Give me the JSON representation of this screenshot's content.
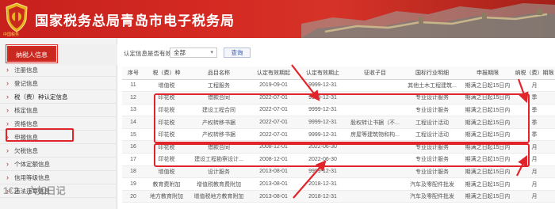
{
  "header": {
    "title": "国家税务总局青岛市电子税务局",
    "emblem_label": "中国税务"
  },
  "sidebar": {
    "head_label": "纳税人信息",
    "items": [
      {
        "label": "注册信息"
      },
      {
        "label": "登记信息"
      },
      {
        "label": "税（费）种认定信息"
      },
      {
        "label": "核定信息"
      },
      {
        "label": "资格信息"
      },
      {
        "label": "申报信息"
      },
      {
        "label": "欠税信息"
      },
      {
        "label": "个体定额信息"
      },
      {
        "label": "信用等级信息"
      },
      {
        "label": "违法违章信息"
      }
    ]
  },
  "filter": {
    "label": "认定信息是否有效:",
    "selected": "全部",
    "query_label": "查询"
  },
  "table": {
    "columns": [
      "序号",
      "税（费）种",
      "品目名称",
      "认定有效期起",
      "认定有效期止",
      "征收子目",
      "国标行业明细",
      "申报期限",
      "纳税（费）期限"
    ],
    "rows": [
      [
        "11",
        "增值税",
        "工程服务",
        "2019-09-01",
        "9999-12-31",
        "",
        "其他土木工程建筑...",
        "期满之日起15日内",
        "月"
      ],
      [
        "12",
        "印花税",
        "借款合同",
        "2022-07-01",
        "9999-12-31",
        "",
        "专业设计服务",
        "期满之日起15日内",
        "季"
      ],
      [
        "13",
        "印花税",
        "建设工程合同",
        "2022-07-01",
        "9999-12-31",
        "",
        "专业设计服务",
        "期满之日起15日内",
        "季"
      ],
      [
        "14",
        "印花税",
        "产权转移书据",
        "2022-07-01",
        "9999-12-31",
        "股权转让书据（不...",
        "工程设计活动",
        "期满之日起15日内",
        "季"
      ],
      [
        "15",
        "印花税",
        "产权转移书据",
        "2022-07-01",
        "9999-12-31",
        "房屋等建筑物和构...",
        "工程设计活动",
        "期满之日起15日内",
        "季"
      ],
      [
        "16",
        "印花税",
        "借款合同",
        "2008-12-01",
        "2022-06-30",
        "",
        "专业设计服务",
        "期满之日起15日内",
        "月"
      ],
      [
        "17",
        "印花税",
        "建设工程勘察设计...",
        "2008-12-01",
        "2022-06-30",
        "",
        "专业设计服务",
        "期满之日起15日内",
        "月"
      ],
      [
        "18",
        "增值税",
        "设计服务",
        "2013-08-01",
        "9999-12-31",
        "",
        "专业设计服务",
        "期满之日起15日内",
        "月"
      ],
      [
        "19",
        "教育费附加",
        "增值税教育费附加",
        "2013-08-01",
        "2018-12-31",
        "",
        "汽车及零配件批发",
        "期满之日起15日内",
        "月"
      ],
      [
        "20",
        "地方教育附加",
        "增值税地方教育附加",
        "2013-08-01",
        "2018-12-31",
        "",
        "汽车及零配件批发",
        "期满之日起15日内",
        "月"
      ]
    ]
  },
  "watermark": "1€2 · 六如日记",
  "colors": {
    "brand_red": "#c8281e",
    "annotation_red": "#e0242a",
    "query_blue": "#3b5ba8"
  }
}
